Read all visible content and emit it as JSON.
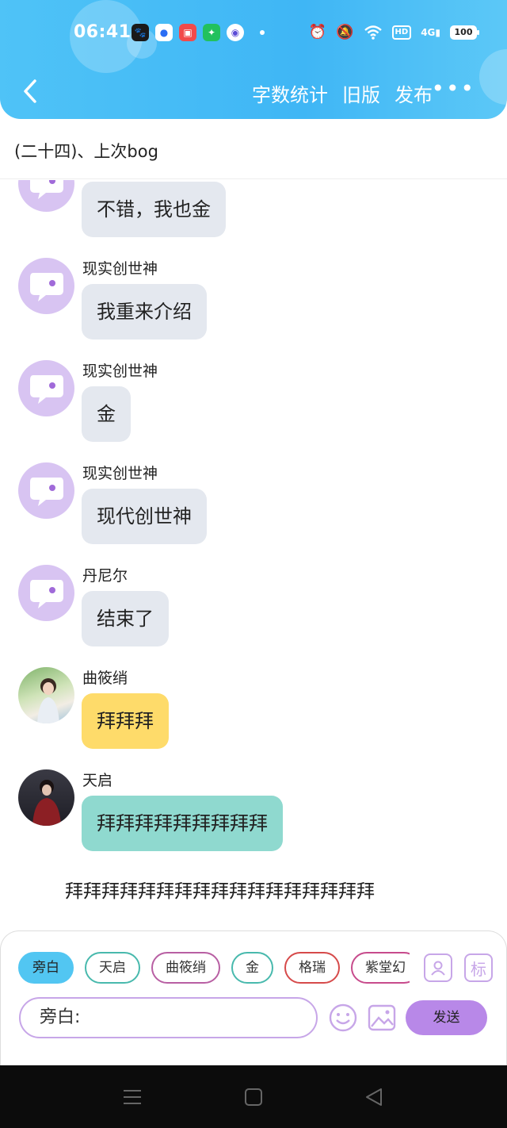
{
  "status_bar": {
    "time": "06:41",
    "battery": "100",
    "network": "4G",
    "hd": "HD"
  },
  "nav": {
    "actions": [
      "字数统计",
      "旧版",
      "发布"
    ],
    "more": "•••"
  },
  "chapter": {
    "title": "(二十四)、上次bog"
  },
  "messages": [
    {
      "sender": "",
      "text": "不错，我也金",
      "style": "grey",
      "avatar": "default"
    },
    {
      "sender": "现实创世神",
      "text": "我重来介绍",
      "style": "grey",
      "avatar": "default"
    },
    {
      "sender": "现实创世神",
      "text": "金",
      "style": "grey",
      "avatar": "default"
    },
    {
      "sender": "现实创世神",
      "text": "现代创世神",
      "style": "grey",
      "avatar": "default"
    },
    {
      "sender": "丹尼尔",
      "text": "结束了",
      "style": "grey",
      "avatar": "default"
    },
    {
      "sender": "曲筱绡",
      "text": "拜拜拜",
      "style": "yellow",
      "avatar": "photo-girl"
    },
    {
      "sender": "天启",
      "text": "拜拜拜拜拜拜拜拜拜",
      "style": "teal",
      "avatar": "photo-man"
    }
  ],
  "narration": "拜拜拜拜拜拜拜拜拜拜拜拜拜拜拜拜拜",
  "composer": {
    "roles": [
      {
        "label": "旁白",
        "color": "#52c6f2",
        "active": true
      },
      {
        "label": "天启",
        "color": "#48b9ad",
        "active": false
      },
      {
        "label": "曲筱绡",
        "color": "#b85fa3",
        "active": false
      },
      {
        "label": "金",
        "color": "#48b9ad",
        "active": false
      },
      {
        "label": "格瑞",
        "color": "#d64a4a",
        "active": false
      },
      {
        "label": "紫堂幻",
        "color": "#c74b8c",
        "active": false
      }
    ],
    "input_value": "旁白:",
    "send_label": "发送",
    "tag_label": "标"
  },
  "colors": {
    "header": "#4fc3f7",
    "accent_purple": "#b888e8",
    "bubble_grey": "#e4e8ef",
    "bubble_yellow": "#fedb6a",
    "bubble_teal": "#8fd9cf"
  }
}
